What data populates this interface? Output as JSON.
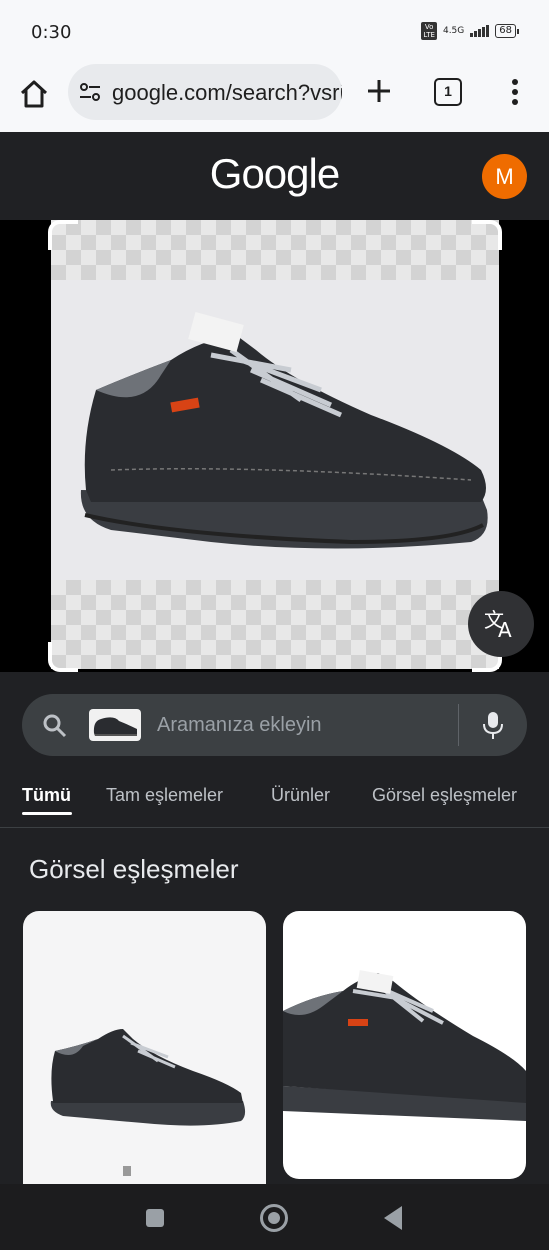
{
  "status_bar": {
    "time": "0:30",
    "volte_label": "Vo LTE",
    "network": "4.5G",
    "battery": "68"
  },
  "browser": {
    "url": "google.com/search?vsrid",
    "tab_count": "1",
    "icons": [
      "home-icon",
      "site-settings-icon",
      "plus-icon",
      "tab-switcher-icon",
      "more-vert-icon"
    ]
  },
  "google": {
    "logo_text": "Google",
    "avatar_letter": "M",
    "avatar_color": "#ef6c00"
  },
  "lens": {
    "translate_icon": "translate-icon"
  },
  "search": {
    "placeholder": "Aramanıza ekleyin"
  },
  "tabs": [
    {
      "label": "Tümü",
      "active": true
    },
    {
      "label": "Tam eşlemeler",
      "active": false
    },
    {
      "label": "Ürünler",
      "active": false
    },
    {
      "label": "Görsel eşleşmeler",
      "active": false
    }
  ],
  "results": {
    "section_title": "Görsel eşleşmeler"
  },
  "colors": {
    "background": "#202124",
    "search_box": "#3c4043",
    "accent": "#ef6c00"
  }
}
